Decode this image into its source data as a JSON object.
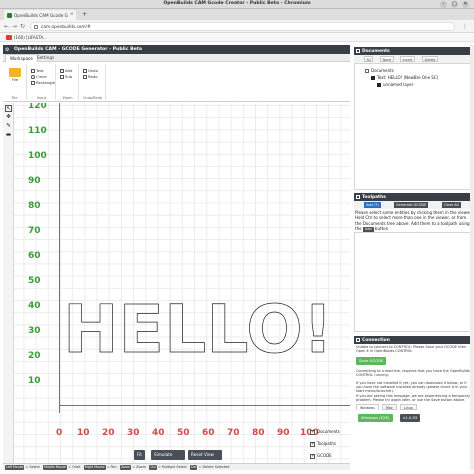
{
  "os": {
    "window_title": "OpenBuilds CAM Gcode Creator - Public Beta - Chromium",
    "controls": [
      "–",
      "□",
      "✕"
    ]
  },
  "browser": {
    "tab_title": "OpenBuilds CAM Gcode G",
    "tab_close": "×",
    "new_tab": "+",
    "url": "cam.openbuilds.com/#",
    "back": "←",
    "forward": "→",
    "reload": "↻",
    "menu": "⋮",
    "bookmark_label": "(160) [LIFASTA..."
  },
  "app": {
    "header_title": "OpenBuilds CAM - GCODE Generator - Public Beta",
    "ribbon_tabs": [
      "Workspace",
      "Settings"
    ],
    "file_group": {
      "big_label": "File",
      "group_label": "File"
    },
    "input_group": {
      "rows": [
        "Text",
        "Circle",
        "Rectangle"
      ],
      "group_label": "Input"
    },
    "zoom_group": {
      "rows": [
        "Add",
        "Sub"
      ],
      "group_label": "Zoom"
    },
    "undo_group": {
      "rows": [
        "Undo",
        "Redo"
      ],
      "group_label": "Undo/Redo"
    },
    "tools": [
      "↖",
      "✥",
      "✎",
      "▬"
    ]
  },
  "viewer": {
    "y_ticks": [
      "120",
      "110",
      "100",
      "90",
      "80",
      "70",
      "60",
      "50",
      "40",
      "30",
      "20",
      "10"
    ],
    "x_ticks": [
      "0",
      "10",
      "20",
      "30",
      "40",
      "50",
      "60",
      "70",
      "80",
      "90",
      "100"
    ],
    "drawn_text": "HELLO!",
    "buttons": [
      "Fit",
      "Simulate",
      "Reset View"
    ],
    "layer_toggles": [
      "Documents",
      "Toolpaths",
      "GCODE"
    ]
  },
  "status_bar": {
    "items": [
      {
        "key": "Left Mouse",
        "text": "Select"
      },
      {
        "key": "Middle Mouse",
        "text": "Orbit"
      },
      {
        "key": "Right Mouse",
        "text": "Pan"
      },
      {
        "key": "Zoom",
        "text": "Zoom"
      },
      {
        "key": "Ctrl",
        "text": "Multiple Select"
      },
      {
        "key": "Del",
        "text": "Delete Selected"
      }
    ]
  },
  "documents": {
    "title": "Documents",
    "toolbar": [
      "All",
      "None",
      "Invert",
      "Delete"
    ],
    "tree": [
      {
        "label": "Documents",
        "level": 0
      },
      {
        "label": "Text: HELLO! (NewBro One SC)",
        "level": 1
      },
      {
        "label": "unnamed layer",
        "level": 2
      }
    ]
  },
  "toolpaths": {
    "title": "Toolpaths",
    "buttons": [
      "Add (T)",
      "Generate GCODE",
      "Clear All"
    ],
    "instructions": "Please select some entities by clicking them in the viewer. Hold Ctrl to select more than one in the viewer, or from the Documents tree above. Add them to a toolpath using the",
    "add_label": "Add",
    "instructions_tail": "button"
  },
  "connection": {
    "title": "Connection",
    "status": "Unable to connect to CONTROL: Please Save your GCODE then Open it in OpenBuilds CONTROL",
    "save_button": "Save GCODE",
    "info1": "Connecting to a machine, requires that you have the OpenBuilds CONTROL running.",
    "info2": "If you have not installed it yet, you can download it below, or if you have the software installed already (please check it in your start menu/launcher).",
    "info3": "If you are seeing this message, we are experiencing a temporary problem. Please try again later, or use the Save button above.",
    "os_tabs": [
      "Windows",
      "Mac",
      "Linux"
    ],
    "download_button": "Windows (EXE)",
    "version": "v1.0.93"
  },
  "colors": {
    "y_axis": "#3a9b3a",
    "x_axis": "#d24b4b",
    "header": "#3a3f47",
    "primary_button": "#2c6fbf",
    "success_button": "#5cb85c"
  }
}
